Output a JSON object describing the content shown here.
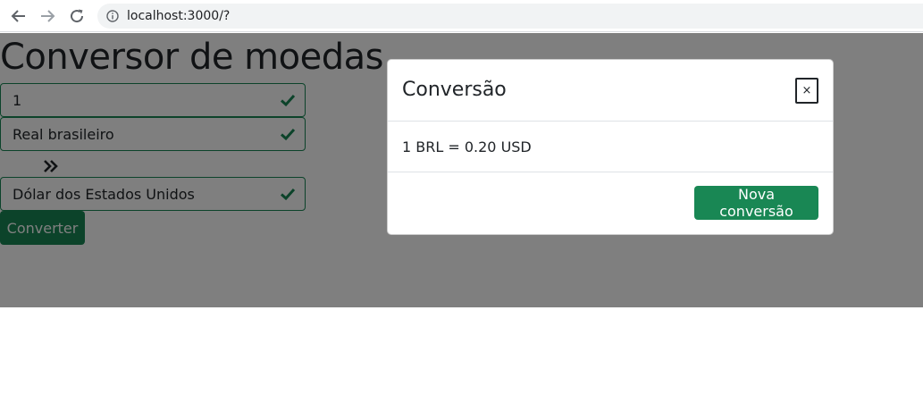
{
  "browser": {
    "url": "localhost:3000/?",
    "back_icon": "arrow-left-icon",
    "forward_icon": "arrow-right-icon",
    "reload_icon": "reload-icon",
    "info_icon": "info-icon"
  },
  "converter": {
    "title": "Conversor de moedas",
    "amount": "1",
    "from_currency": "Real brasileiro",
    "to_currency": "Dólar dos Estados Unidos",
    "convert_label": "Converter",
    "swap_icon": "double-chevron-right-icon",
    "valid_icon": "check-icon"
  },
  "modal": {
    "title": "Conversão",
    "close_label": "×",
    "result": "1 BRL = 0.20 USD",
    "new_conversion_label": "Nova conversão"
  },
  "colors": {
    "success": "#198754",
    "backdrop": "rgba(0,0,0,0.5)"
  }
}
